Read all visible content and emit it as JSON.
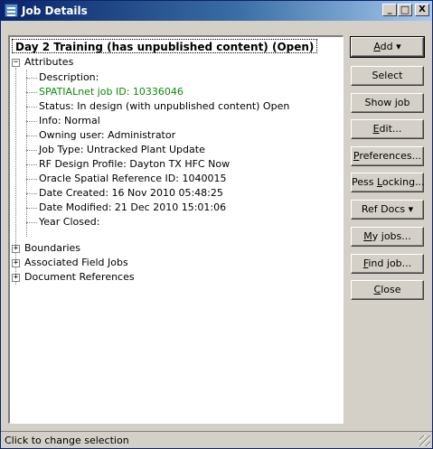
{
  "window": {
    "title": "Job Details",
    "buttons": {
      "minimize": "_",
      "maximize": "□",
      "close": "X"
    }
  },
  "tree": {
    "root_label": "Day 2 Training   (has unpublished content) (Open)",
    "attributes": {
      "label": "Attributes",
      "expander": "−",
      "items": [
        "Description:",
        "SPATIALnet job ID: 10336046",
        "Status:  In design (with unpublished content) Open",
        "Info: Normal",
        "Owning user: Administrator",
        "Job Type: Untracked Plant Update",
        "RF Design Profile: Dayton TX HFC Now",
        "Oracle Spatial Reference ID: 1040015",
        "Date Created: 16 Nov 2010 05:48:25",
        "Date Modified: 21 Dec 2010 15:01:06",
        "Year Closed:"
      ]
    },
    "groups": [
      {
        "label": "Boundaries",
        "expander": "+"
      },
      {
        "label": "Associated Field Jobs",
        "expander": "+"
      },
      {
        "label": "Document References",
        "expander": "+"
      }
    ],
    "highlight_color": "#0a8a0a"
  },
  "buttons": {
    "add": {
      "pre": "",
      "u": "A",
      "post": "dd ▾"
    },
    "select": {
      "pre": "Select",
      "u": "",
      "post": ""
    },
    "show_job": {
      "pre": "Show job",
      "u": "",
      "post": ""
    },
    "edit": {
      "pre": "",
      "u": "E",
      "post": "dit..."
    },
    "preferences": {
      "pre": "",
      "u": "P",
      "post": "references..."
    },
    "pess_locking": {
      "pre": "Pess ",
      "u": "L",
      "post": "ocking..."
    },
    "ref_docs": {
      "pre": "Ref Docs ▾",
      "u": "",
      "post": ""
    },
    "my_jobs": {
      "pre": "",
      "u": "M",
      "post": "y jobs..."
    },
    "find_job": {
      "pre": "",
      "u": "F",
      "post": "ind job..."
    },
    "close": {
      "pre": "",
      "u": "C",
      "post": "lose"
    }
  },
  "statusbar": {
    "text": "Click to change selection"
  }
}
